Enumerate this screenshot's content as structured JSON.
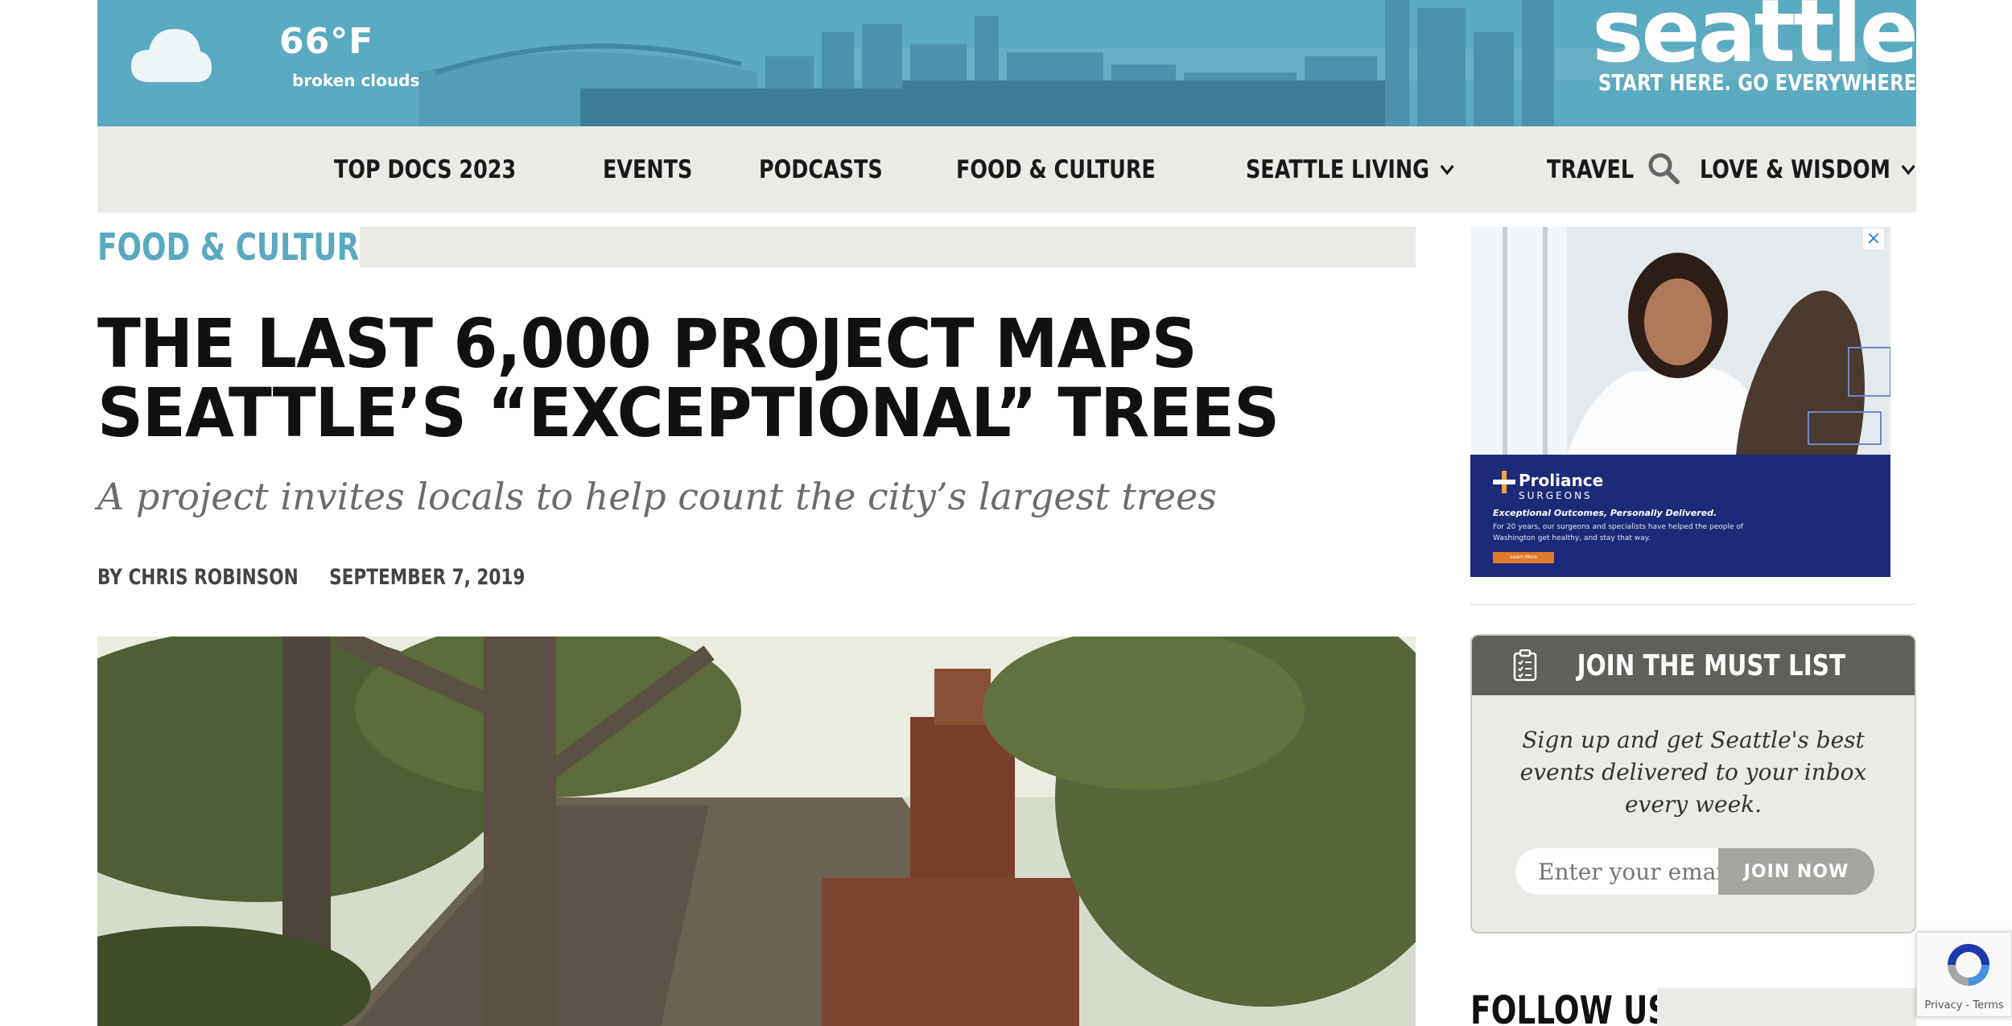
{
  "weather": {
    "temperature": "66°F",
    "condition": "broken clouds",
    "icon": "cloud-icon"
  },
  "logo": {
    "word": "seattle",
    "tagline": "START HERE. GO EVERYWHERE"
  },
  "nav": {
    "items": [
      {
        "label": "TOP DOCS 2023",
        "dropdown": false
      },
      {
        "label": "EVENTS",
        "dropdown": false
      },
      {
        "label": "PODCASTS",
        "dropdown": false
      },
      {
        "label": "FOOD & CULTURE",
        "dropdown": false
      },
      {
        "label": "SEATTLE LIVING",
        "dropdown": true
      },
      {
        "label": "TRAVEL",
        "dropdown": false
      },
      {
        "label": "LOVE & WISDOM",
        "dropdown": true
      }
    ],
    "search_icon": "search-icon"
  },
  "article": {
    "section": "FOOD & CULTURE",
    "headline": "THE LAST 6,000 PROJECT MAPS SEATTLE’S “EXCEPTIONAL” TREES",
    "dek": "A project invites locals to help count the city’s largest trees",
    "byline": "BY CHRIS ROBINSON",
    "date": "SEPTEMBER 7, 2019"
  },
  "ad": {
    "close": "×",
    "brand": "Proliance",
    "brand_sub": "SURGEONS",
    "headline": "Exceptional Outcomes, Personally Delivered.",
    "body": "For 20 years, our surgeons and specialists have helped the people of Washington get healthy, and stay that way.",
    "button": "Learn More"
  },
  "must_list": {
    "title": "JOIN THE MUST LIST",
    "text": "Sign up and get Seattle's best events delivered to your inbox every week.",
    "input_placeholder": "Enter your email",
    "button": "JOIN NOW"
  },
  "follow": {
    "title": "FOLLOW US"
  },
  "recaptcha": {
    "links": "Privacy - Terms"
  },
  "colors": {
    "accent": "#59a9c0",
    "nav_bg": "#ebeae6",
    "must_header": "#615f5a",
    "ad_blue": "#1d2a7a"
  }
}
